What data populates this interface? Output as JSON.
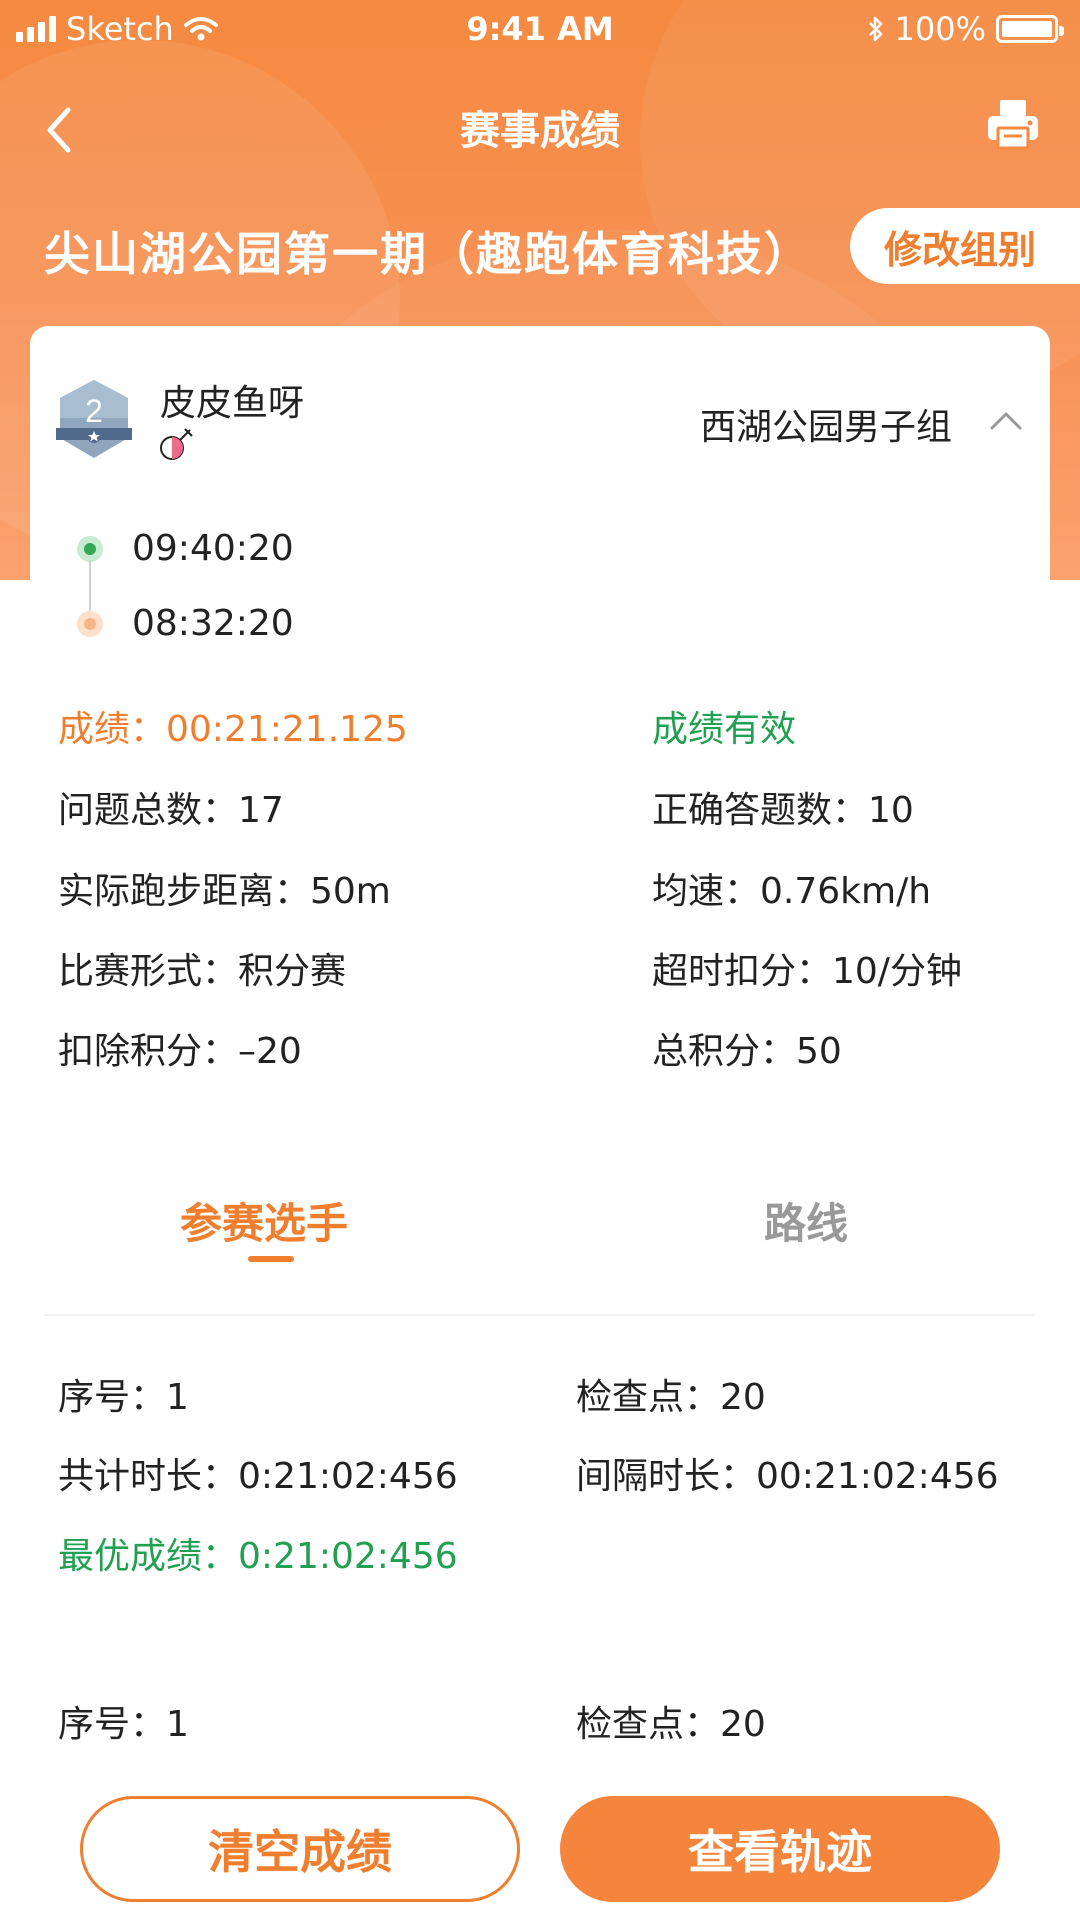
{
  "status_bar": {
    "carrier": "Sketch",
    "time": "9:41 AM",
    "battery": "100%",
    "battery_level": 1.0
  },
  "nav": {
    "title": "赛事成绩",
    "back_icon": "chevron-left-icon",
    "print_icon": "printer-icon"
  },
  "event": {
    "title": "尖山湖公园第一期（趣跑体育科技）",
    "modify_group_label": "修改组别"
  },
  "player": {
    "rank": "2",
    "name": "皮皮鱼呀",
    "gender_icon": "female-icon",
    "group": "西湖公园男子组"
  },
  "timeline": {
    "start": "09:40:20",
    "end": "08:32:20"
  },
  "stats": {
    "score": "成绩：00:21:21.125",
    "validity": "成绩有效",
    "question_total": "问题总数：17",
    "correct_count": "正确答题数：10",
    "distance": "实际跑步距离：50m",
    "avg_speed": "均速：0.76km/h",
    "race_format": "比赛形式：积分赛",
    "overtime_penalty": "超时扣分：10/分钟",
    "deducted_points": "扣除积分：–20",
    "total_points": "总积分：50"
  },
  "tabs": [
    {
      "label": "参赛选手",
      "active": true
    },
    {
      "label": "路线",
      "active": false
    }
  ],
  "records": [
    {
      "index": "序号：1",
      "checkpoint": "检查点：20",
      "total_duration": "共计时长：0:21:02:456",
      "interval": "间隔时长：00:21:02:456",
      "best": "最优成绩：0:21:02:456"
    },
    {
      "index": "序号：1",
      "checkpoint": "检查点：20"
    }
  ],
  "buttons": {
    "clear": "清空成绩",
    "track": "查看轨迹"
  },
  "colors": {
    "accent": "#f07e2f",
    "valid": "#20a050",
    "header_bg": "#f58a40"
  }
}
